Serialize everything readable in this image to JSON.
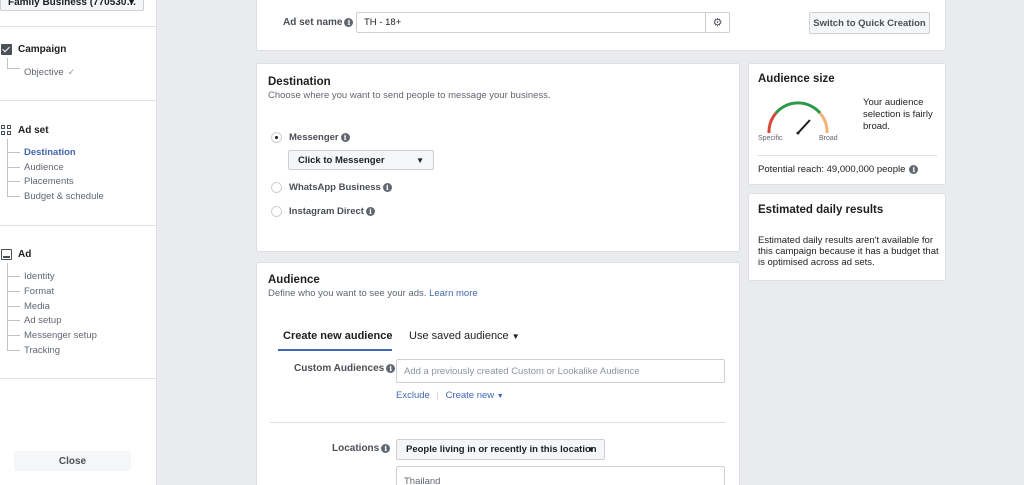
{
  "nav": {
    "account": "Family Business (770530…",
    "campaign": {
      "label": "Campaign",
      "items": [
        "Objective"
      ]
    },
    "adset": {
      "label": "Ad set",
      "items": [
        "Destination",
        "Audience",
        "Placements",
        "Budget & schedule"
      ]
    },
    "ad": {
      "label": "Ad",
      "items": [
        "Identity",
        "Format",
        "Media",
        "Ad setup",
        "Messenger setup",
        "Tracking"
      ]
    },
    "close": "Close"
  },
  "adset_name": {
    "label": "Ad set name",
    "value": "TH - 18+",
    "switch_button": "Switch to Quick Creation"
  },
  "destination": {
    "title": "Destination",
    "description": "Choose where you want to send people to message your business.",
    "options": [
      "Messenger",
      "WhatsApp Business",
      "Instagram Direct"
    ],
    "selected": "Messenger",
    "messenger_dropdown": "Click to Messenger"
  },
  "audience": {
    "title": "Audience",
    "description": "Define who you want to see your ads.",
    "learn_more": "Learn more",
    "tabs": [
      "Create new audience",
      "Use saved audience"
    ],
    "custom_label": "Custom Audiences",
    "custom_placeholder": "Add a previously created Custom or Lookalike Audience",
    "exclude": "Exclude",
    "create_new": "Create new",
    "locations_label": "Locations",
    "locations_dropdown": "People living in or recently in this location",
    "location_value": "Thailand"
  },
  "audience_size": {
    "title": "Audience size",
    "summary": "Your audience selection is fairly broad.",
    "specific": "Specific",
    "broad": "Broad",
    "reach": "Potential reach: 49,000,000 people"
  },
  "daily_results": {
    "title": "Estimated daily results",
    "text": "Estimated daily results aren't available for this campaign because it has a budget that is optimised across ad sets."
  },
  "colors": {
    "link": "#4267b2",
    "gauge_red": "#d94a38",
    "gauge_green": "#2a9a47",
    "gauge_orange": "#f2b37b"
  }
}
